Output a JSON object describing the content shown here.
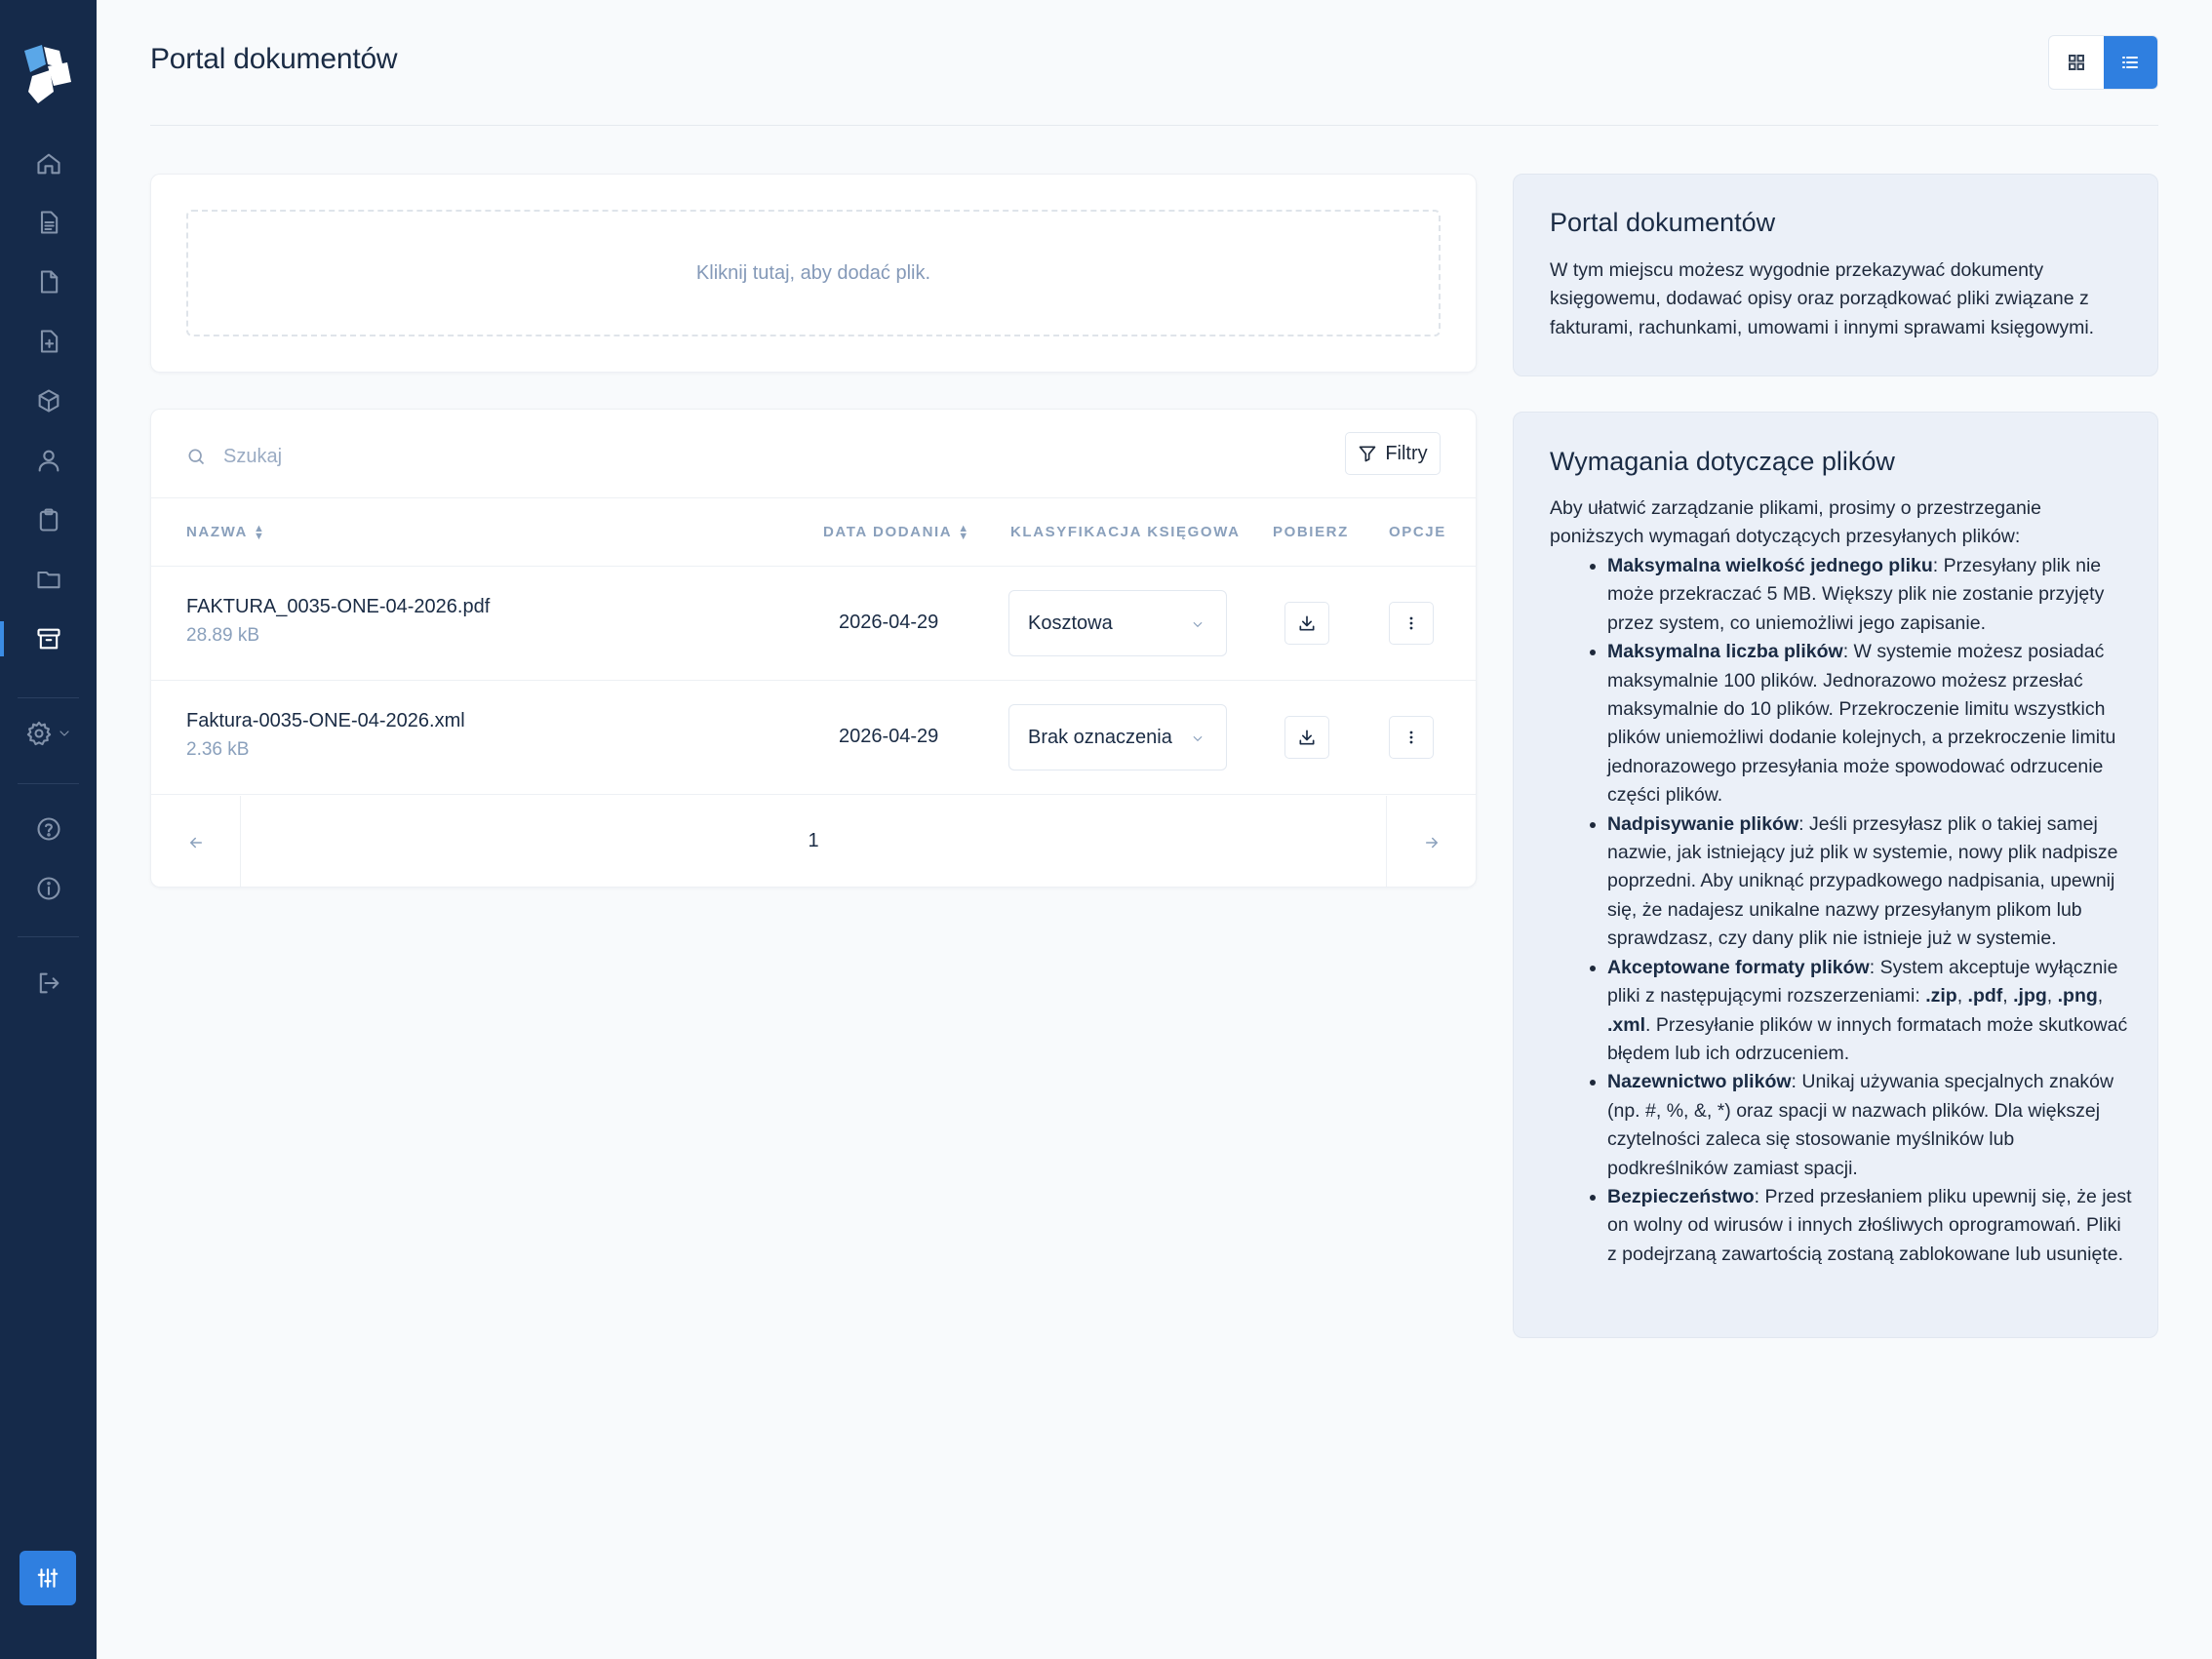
{
  "header": {
    "title": "Portal dokumentów"
  },
  "sidebar": {
    "items": [
      {
        "icon": "home-icon"
      },
      {
        "icon": "document-text-icon"
      },
      {
        "icon": "document-icon"
      },
      {
        "icon": "document-add-icon"
      },
      {
        "icon": "cube-icon"
      },
      {
        "icon": "user-icon"
      },
      {
        "icon": "clipboard-icon"
      },
      {
        "icon": "folder-icon"
      },
      {
        "icon": "archive-icon",
        "active": true
      },
      {
        "icon": "gear-icon"
      },
      {
        "icon": "help-circle-icon"
      },
      {
        "icon": "info-circle-icon"
      },
      {
        "icon": "logout-icon"
      }
    ],
    "accent": "#2f7fe0",
    "background": "#152a4a"
  },
  "upload": {
    "placeholder": "Kliknij tutaj, aby dodać plik."
  },
  "search": {
    "placeholder": "Szukaj"
  },
  "filter": {
    "label": "Filtry"
  },
  "table": {
    "columns": {
      "name": "NAZWA",
      "date": "DATA DODANIA",
      "classification": "KLASYFIKACJA KSIĘGOWA",
      "download": "POBIERZ",
      "options": "OPCJE"
    },
    "rows": [
      {
        "name": "FAKTURA_0035-ONE-04-2026.pdf",
        "size": "28.89 kB",
        "date": "2026-04-29",
        "classification": "Kosztowa"
      },
      {
        "name": "Faktura-0035-ONE-04-2026.xml",
        "size": "2.36 kB",
        "date": "2026-04-29",
        "classification": "Brak oznaczenia"
      }
    ]
  },
  "pagination": {
    "current": "1"
  },
  "info_portal": {
    "title": "Portal dokumentów",
    "body": "W tym miejscu możesz wygodnie przekazywać dokumenty księgowemu, dodawać opisy oraz porządkować pliki związane z fakturami, rachunkami, umowami i innymi sprawami księgowymi."
  },
  "info_requirements": {
    "title": "Wymagania dotyczące plików",
    "intro": "Aby ułatwić zarządzanie plikami, prosimy o przestrzeganie poniższych wymagań dotyczących przesyłanych plików:",
    "items": [
      {
        "label": "Maksymalna wielkość jednego pliku",
        "text": ": Przesyłany plik nie może przekraczać 5 MB. Większy plik nie zostanie przyjęty przez system, co uniemożliwi jego zapisanie."
      },
      {
        "label": "Maksymalna liczba plików",
        "text": ": W systemie możesz posiadać maksymalnie 100 plików. Jednorazowo możesz przesłać maksymalnie do 10 plików. Przekroczenie limitu wszystkich plików uniemożliwi dodanie kolejnych, a przekroczenie limitu jednorazowego przesyłania może spowodować odrzucenie części plików."
      },
      {
        "label": "Nadpisywanie plików",
        "text": ": Jeśli przesyłasz plik o takiej samej nazwie, jak istniejący już plik w systemie, nowy plik nadpisze poprzedni. Aby uniknąć przypadkowego nadpisania, upewnij się, że nadajesz unikalne nazwy przesyłanym plikom lub sprawdzasz, czy dany plik nie istnieje już w systemie."
      },
      {
        "label": "Akceptowane formaty plików",
        "text_a": ": System akceptuje wyłącznie pliki z następującymi rozszerzeniami: ",
        "formats": [
          ".zip",
          ".pdf",
          ".jpg",
          ".png",
          ".xml"
        ],
        "sep": ", ",
        "text_b": ". Przesyłanie plików w innych formatach może skutkować błędem lub ich odrzuceniem."
      },
      {
        "label": "Nazewnictwo plików",
        "text": ": Unikaj używania specjalnych znaków (np. #, %, &, *) oraz spacji w nazwach plików. Dla większej czytelności zaleca się stosowanie myślników lub podkreślników zamiast spacji."
      },
      {
        "label": "Bezpieczeństwo",
        "text": ": Przed przesłaniem pliku upewnij się, że jest on wolny od wirusów i innych złośliwych oprogramowań. Pliki z podejrzaną zawartością zostaną zablokowane lub usunięte."
      }
    ]
  }
}
